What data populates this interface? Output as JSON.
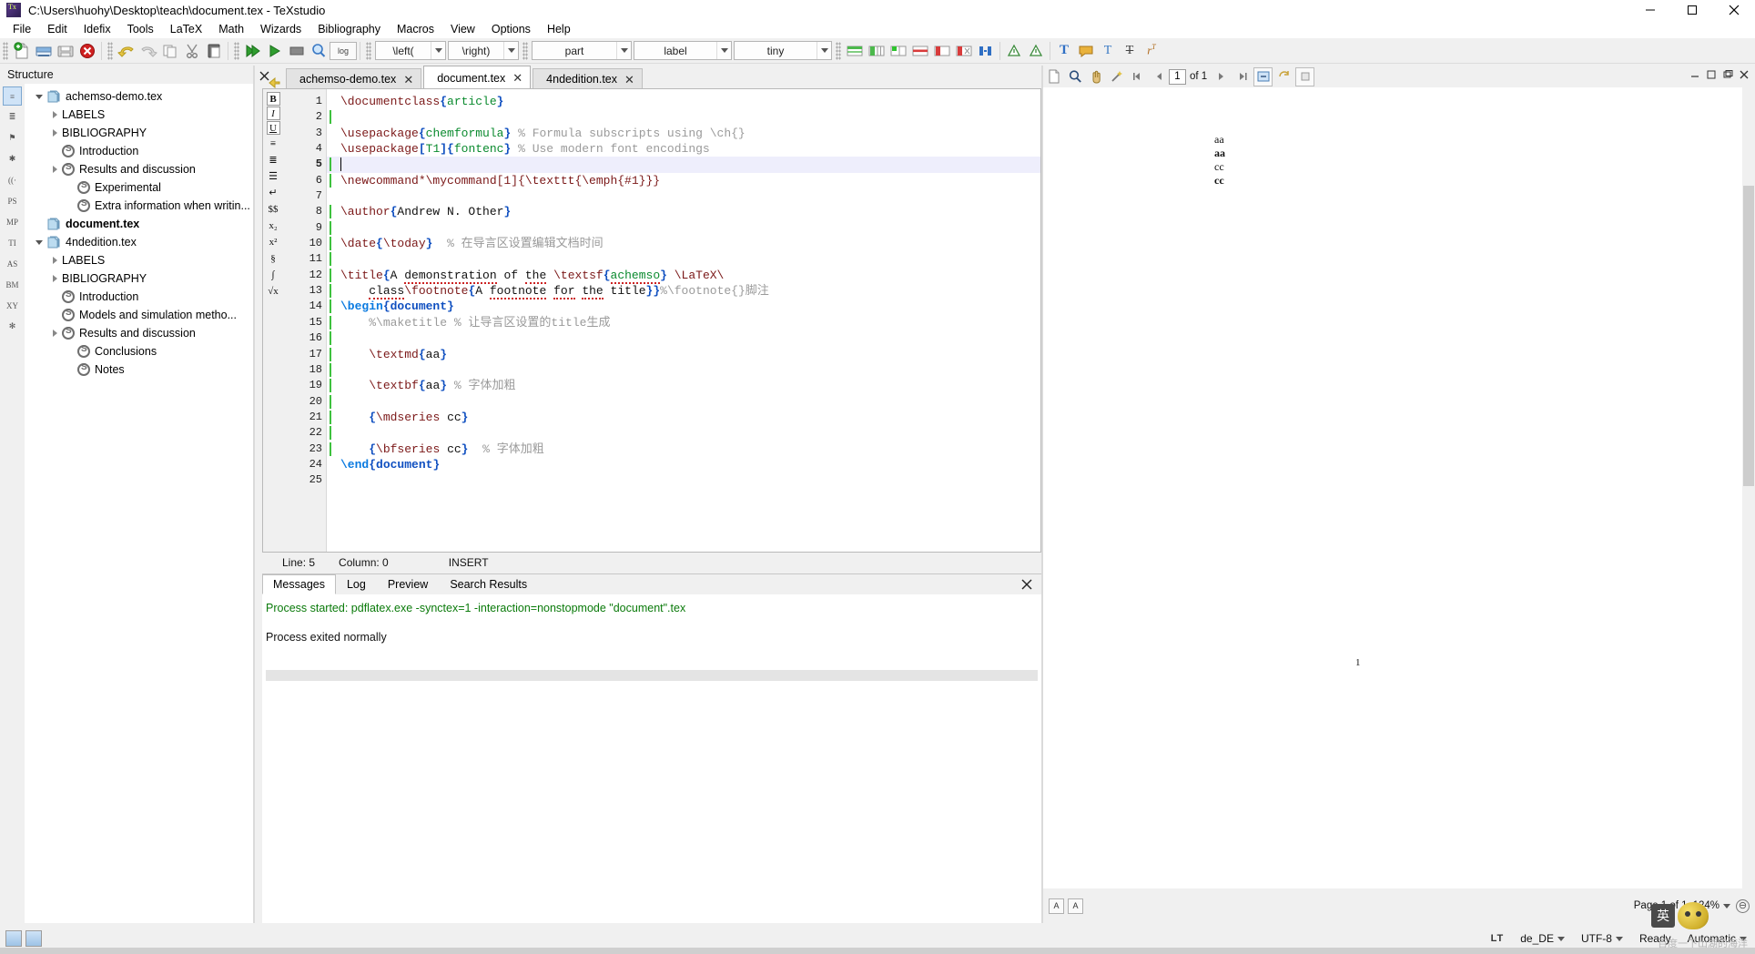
{
  "window": {
    "title": "C:\\Users\\huohy\\Desktop\\teach\\document.tex - TeXstudio",
    "app_icon": "texstudio-icon",
    "minimize": "—",
    "maximize": "❐",
    "close": "✕"
  },
  "menubar": {
    "items": [
      {
        "label": "File"
      },
      {
        "label": "Edit"
      },
      {
        "label": "Idefix"
      },
      {
        "label": "Tools"
      },
      {
        "label": "LaTeX"
      },
      {
        "label": "Math"
      },
      {
        "label": "Wizards"
      },
      {
        "label": "Bibliography"
      },
      {
        "label": "Macros"
      },
      {
        "label": "View"
      },
      {
        "label": "Options"
      },
      {
        "label": "Help"
      }
    ]
  },
  "toolbar": {
    "icons": [
      {
        "name": "new-document-icon"
      },
      {
        "name": "open-document-icon"
      },
      {
        "name": "save-document-icon"
      },
      {
        "name": "close-document-icon"
      },
      {
        "name": "undo-icon"
      },
      {
        "name": "redo-icon"
      },
      {
        "name": "copy-icon"
      },
      {
        "name": "cut-icon"
      },
      {
        "name": "paste-icon"
      },
      {
        "name": "build-and-view-icon"
      },
      {
        "name": "compile-icon"
      },
      {
        "name": "view-pdf-icon"
      },
      {
        "name": "magnify-icon"
      },
      {
        "name": "view-log-icon"
      }
    ],
    "log_label": "log",
    "combos": [
      {
        "name": "left-delimiter-combo",
        "value": "\\left("
      },
      {
        "name": "right-delimiter-combo",
        "value": "\\right)"
      },
      {
        "name": "section-level-combo",
        "value": "part"
      },
      {
        "name": "label-combo",
        "value": "label"
      },
      {
        "name": "font-size-combo",
        "value": "tiny"
      }
    ],
    "table_icons": [
      {
        "name": "insert-table-icon"
      },
      {
        "name": "table-columns-icon"
      },
      {
        "name": "add-column-icon"
      },
      {
        "name": "table-rows-icon"
      },
      {
        "name": "delete-row-icon"
      },
      {
        "name": "delete-column-icon"
      },
      {
        "name": "align-columns-icon"
      },
      {
        "name": "warning-triangle-icon"
      },
      {
        "name": "warning-triangle-2-icon"
      },
      {
        "name": "text-bold-big-icon"
      },
      {
        "name": "comment-icon"
      },
      {
        "name": "text-format-icon"
      },
      {
        "name": "strikethrough-icon"
      },
      {
        "name": "superscript-icon"
      }
    ]
  },
  "structure": {
    "header": "Structure",
    "close_icon": "✕",
    "side_buttons": [
      {
        "name": "structure-view-button",
        "label": "≡",
        "active": true
      },
      {
        "name": "toc-view-button",
        "label": "≣"
      },
      {
        "name": "bookmarks-button",
        "label": "⚑"
      },
      {
        "name": "symbols-button",
        "label": "✱"
      },
      {
        "name": "brackets-button",
        "label": "((·"
      },
      {
        "name": "ps-symbols-button",
        "label": "PS"
      },
      {
        "name": "mp-symbols-button",
        "label": "MP"
      },
      {
        "name": "ti-symbols-button",
        "label": "TI"
      },
      {
        "name": "as-symbols-button",
        "label": "AS"
      },
      {
        "name": "bm-symbols-button",
        "label": "BM"
      },
      {
        "name": "xy-symbols-button",
        "label": "XY"
      },
      {
        "name": "favorites-button",
        "label": "✻"
      }
    ],
    "tree": [
      {
        "label": "achemso-demo.tex",
        "indent": 0,
        "twist": "down",
        "icon": "document-icon",
        "bold": false
      },
      {
        "label": "LABELS",
        "indent": 1,
        "twist": "right",
        "icon": "none",
        "bold": false
      },
      {
        "label": "BIBLIOGRAPHY",
        "indent": 1,
        "twist": "right",
        "icon": "none",
        "bold": false
      },
      {
        "label": "Introduction",
        "indent": 1,
        "twist": "none",
        "icon": "section-icon",
        "bold": false
      },
      {
        "label": "Results and discussion",
        "indent": 1,
        "twist": "right",
        "icon": "section-icon",
        "bold": false
      },
      {
        "label": "Experimental",
        "indent": 2,
        "twist": "none",
        "icon": "section-icon",
        "bold": false
      },
      {
        "label": "Extra information when writin...",
        "indent": 2,
        "twist": "none",
        "icon": "section-icon",
        "bold": false
      },
      {
        "label": "document.tex",
        "indent": 0,
        "twist": "none",
        "icon": "document-icon",
        "bold": true
      },
      {
        "label": "4ndedition.tex",
        "indent": 0,
        "twist": "down",
        "icon": "document-icon",
        "bold": false
      },
      {
        "label": "LABELS",
        "indent": 1,
        "twist": "right",
        "icon": "none",
        "bold": false
      },
      {
        "label": "BIBLIOGRAPHY",
        "indent": 1,
        "twist": "right",
        "icon": "none",
        "bold": false
      },
      {
        "label": "Introduction",
        "indent": 1,
        "twist": "none",
        "icon": "section-icon",
        "bold": false
      },
      {
        "label": "Models and simulation metho...",
        "indent": 1,
        "twist": "none",
        "icon": "section-icon",
        "bold": false
      },
      {
        "label": "Results and discussion",
        "indent": 1,
        "twist": "right",
        "icon": "section-icon",
        "bold": false
      },
      {
        "label": "Conclusions",
        "indent": 2,
        "twist": "none",
        "icon": "section-icon",
        "bold": false
      },
      {
        "label": "Notes",
        "indent": 2,
        "twist": "none",
        "icon": "section-icon",
        "bold": false
      }
    ]
  },
  "editor": {
    "close_icon": "✕",
    "nav_back_icon": "arrow-left-icon",
    "nav_forward_icon": "arrow-right-icon",
    "tabs": [
      {
        "label": "achemso-demo.tex",
        "active": false,
        "close": "✕"
      },
      {
        "label": "document.tex",
        "active": true,
        "close": "✕"
      },
      {
        "label": "4ndedition.tex",
        "active": false,
        "close": "✕"
      }
    ],
    "format_buttons": [
      {
        "name": "bold-button",
        "label": "B"
      },
      {
        "name": "italic-button",
        "label": "I"
      },
      {
        "name": "underline-button",
        "label": "U"
      },
      {
        "name": "paragraph-button",
        "label": "≡"
      },
      {
        "name": "center-button",
        "label": "≣"
      },
      {
        "name": "list-button",
        "label": "☰"
      },
      {
        "name": "newline-button",
        "label": "↵"
      },
      {
        "name": "math-inline-button",
        "label": "$$"
      },
      {
        "name": "subscript-button",
        "label": "x₂"
      },
      {
        "name": "superscript-button",
        "label": "x²"
      },
      {
        "name": "section-button",
        "label": "§"
      },
      {
        "name": "frac-button",
        "label": "∫"
      },
      {
        "name": "sqrt-button",
        "label": "√x"
      }
    ],
    "line_count": 25,
    "current_line": 5,
    "fold_lines": [
      12,
      14
    ],
    "lines": [
      {
        "n": 1,
        "html": "<span class='k-cmd'>\\documentclass</span><span class='k-brace'>{</span><span class='k-arg'>article</span><span class='k-brace'>}</span>",
        "mark": false
      },
      {
        "n": 2,
        "html": "",
        "mark": true
      },
      {
        "n": 3,
        "html": "<span class='k-cmd'>\\usepackage</span><span class='k-brace'>{</span><span class='k-arg'>chemformula</span><span class='k-brace'>}</span> <span class='k-cmt'>% Formula subscripts using \\ch{}</span>",
        "mark": false
      },
      {
        "n": 4,
        "html": "<span class='k-cmd'>\\usepackage</span><span class='k-brace'>[</span><span class='k-arg'>T1</span><span class='k-brace'>]{</span><span class='k-arg'>fontenc</span><span class='k-brace'>}</span> <span class='k-cmt'>% Use modern font encodings</span>",
        "mark": false
      },
      {
        "n": 5,
        "html": "",
        "mark": true
      },
      {
        "n": 6,
        "html": "<span class='k-cmd'>\\newcommand*\\mycommand[1]{\\texttt{\\emph{#1}}}</span>",
        "mark": true
      },
      {
        "n": 7,
        "html": "",
        "mark": false
      },
      {
        "n": 8,
        "html": "<span class='k-cmd'>\\author</span><span class='k-brace'>{</span><span class='k-txt'>Andrew N. Other</span><span class='k-brace'>}</span>",
        "mark": true
      },
      {
        "n": 9,
        "html": "",
        "mark": true
      },
      {
        "n": 10,
        "html": "<span class='k-cmd'>\\date</span><span class='k-brace'>{</span><span class='k-cmd'>\\today</span><span class='k-brace'>}</span>  <span class='k-cmt'>% 在导言区设置编辑文档时间</span>",
        "mark": true
      },
      {
        "n": 11,
        "html": "",
        "mark": true
      },
      {
        "n": 12,
        "html": "<span class='k-cmd'>\\title</span><span class='k-brace'>{</span><span class='k-txt'>A <span class='spell'>demonstration</span> of <span class='spell'>the</span> </span><span class='k-cmd'>\\textsf</span><span class='k-brace'>{</span><span class='k-arg spell'>achemso</span><span class='k-brace'>}</span> <span class='k-cmd'>\\LaTeX\\</span>",
        "mark": true
      },
      {
        "n": 13,
        "html": "    <span class='k-txt spell'>class</span><span class='k-cmd'>\\footnote</span><span class='k-brace'>{</span><span class='k-txt'>A <span class='spell'>footnote</span> <span class='spell'>for</span> <span class='spell'>the</span> title</span><span class='k-brace'>}}</span><span class='k-cmt'>%\\footnote{}脚注</span>",
        "mark": true
      },
      {
        "n": 14,
        "html": "<span class='k-cmd2'>\\begin</span><span class='k-brace'>{</span><span class='k-brace'>document</span><span class='k-brace'>}</span>",
        "mark": true
      },
      {
        "n": 15,
        "html": "    <span class='k-cmt'>%\\maketitle % 让导言区设置的title生成</span>",
        "mark": true
      },
      {
        "n": 16,
        "html": "",
        "mark": true
      },
      {
        "n": 17,
        "html": "    <span class='k-cmd'>\\textmd</span><span class='k-brace'>{</span><span class='k-txt'>aa</span><span class='k-brace'>}</span>",
        "mark": true
      },
      {
        "n": 18,
        "html": "",
        "mark": true
      },
      {
        "n": 19,
        "html": "    <span class='k-cmd'>\\textbf</span><span class='k-brace'>{</span><span class='k-txt'>aa</span><span class='k-brace'>}</span> <span class='k-cmt'>% 字体加粗</span>",
        "mark": true
      },
      {
        "n": 20,
        "html": "",
        "mark": true
      },
      {
        "n": 21,
        "html": "    <span class='k-brace'>{</span><span class='k-cmd'>\\mdseries</span> <span class='k-txt'>cc</span><span class='k-brace'>}</span>",
        "mark": true
      },
      {
        "n": 22,
        "html": "",
        "mark": true
      },
      {
        "n": 23,
        "html": "    <span class='k-brace'>{</span><span class='k-cmd'>\\bfseries</span> <span class='k-txt'>cc</span><span class='k-brace'>}</span>  <span class='k-cmt'>% 字体加粗</span>",
        "mark": true
      },
      {
        "n": 24,
        "html": "<span class='k-cmd2'>\\end</span><span class='k-brace'>{</span><span class='k-brace'>document</span><span class='k-brace'>}</span>",
        "mark": false
      },
      {
        "n": 25,
        "html": "",
        "mark": false
      }
    ],
    "status": {
      "line_label": "Line: 5",
      "column_label": "Column: 0",
      "mode_label": "INSERT"
    }
  },
  "messages": {
    "tabs": [
      {
        "label": "Messages",
        "active": true
      },
      {
        "label": "Log",
        "active": false
      },
      {
        "label": "Preview",
        "active": false
      },
      {
        "label": "Search Results",
        "active": false
      }
    ],
    "close_icon": "✕",
    "line1": "Process started: pdflatex.exe  -synctex=1 -interaction=nonstopmode \"document\".tex",
    "line2": "Process exited normally"
  },
  "pdf_viewer": {
    "toolbar_icons": [
      {
        "name": "pdf-document-icon"
      },
      {
        "name": "pdf-search-icon"
      },
      {
        "name": "pdf-hand-tool-icon"
      },
      {
        "name": "pdf-magic-wand-icon"
      },
      {
        "name": "pdf-first-page-icon"
      },
      {
        "name": "pdf-prev-page-icon"
      }
    ],
    "page_input_value": "1",
    "page_of_label": "of 1",
    "toolbar_icons2": [
      {
        "name": "pdf-next-page-icon"
      },
      {
        "name": "pdf-last-page-icon"
      },
      {
        "name": "pdf-fit-width-icon"
      },
      {
        "name": "pdf-sync-icon"
      },
      {
        "name": "pdf-settings-icon"
      }
    ],
    "window_buttons": [
      {
        "name": "pdf-minimize-button",
        "label": "—"
      },
      {
        "name": "pdf-restore-button",
        "label": "❐"
      },
      {
        "name": "pdf-float-button",
        "label": "❑"
      },
      {
        "name": "pdf-close-button",
        "label": "✕"
      }
    ],
    "page_content_lines": [
      "aa",
      "aa",
      "cc",
      "cc"
    ],
    "page_number_text": "1",
    "status": {
      "left_icons": [
        {
          "name": "pdf-magnify-minus-icon",
          "label": "A"
        },
        {
          "name": "pdf-magnify-plus-icon",
          "label": "A"
        }
      ],
      "page_label": "Page 1 of 1",
      "zoom_label": "124%",
      "fit_icon": "⊖"
    }
  },
  "statusbar": {
    "left_buttons": [
      {
        "name": "toggle-structure-panel-button"
      },
      {
        "name": "toggle-output-panel-button"
      }
    ],
    "cells": [
      {
        "name": "language-tool-badge",
        "label": "LT"
      },
      {
        "name": "spell-language-cell",
        "label": "de_DE",
        "dropdown": true
      },
      {
        "name": "encoding-cell",
        "label": "UTF-8",
        "dropdown": true
      },
      {
        "name": "ready-cell",
        "label": "Ready",
        "dropdown": false
      },
      {
        "name": "automatic-cell",
        "label": "Automatic",
        "dropdown": true
      }
    ]
  },
  "ime_widget": {
    "mode_label": "英",
    "mascot": "pig-mascot-icon"
  },
  "watermark": "百度一下山湖的海洋",
  "colors": {
    "window_bg": "#f0f0f0",
    "editor_bg": "#ffffff",
    "gutter_bg": "#f0f0f0",
    "current_line": "#eeeefc",
    "command_red": "#7b1818",
    "arg_green": "#0a8a2e",
    "brace_blue": "#0f4fc0",
    "env_blue": "#0a7ae0",
    "comment_gray": "#9a9a9a",
    "modified_mark_green": "#3ec13e",
    "message_success": "#0a7a0a",
    "spell_error": "#cc2222"
  }
}
